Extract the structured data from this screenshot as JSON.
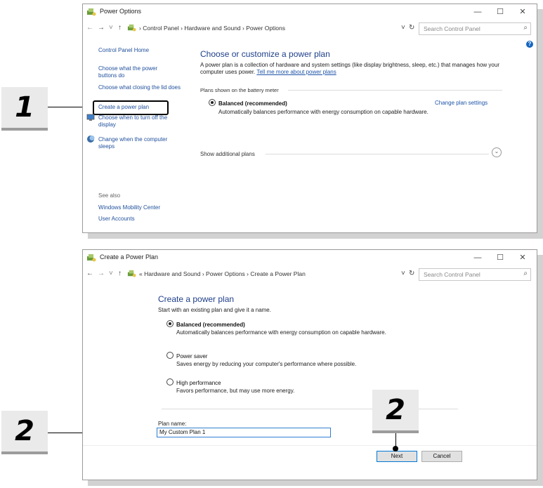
{
  "badges": {
    "one": "1",
    "two_left": "2",
    "two_right": "2"
  },
  "window1": {
    "title": "Power Options",
    "controls": {
      "min": "—",
      "max": "☐",
      "close": "✕"
    },
    "nav": {
      "back": "←",
      "forward": "→",
      "dropdown": "˅",
      "up": "↑"
    },
    "breadcrumb": [
      "Control Panel",
      "Hardware and Sound",
      "Power Options"
    ],
    "crumb_sep": "›",
    "refresh": "↻",
    "search_placeholder": "Search Control Panel",
    "help": "?",
    "sidebar": {
      "home": "Control Panel Home",
      "items": [
        "Choose what the power buttons do",
        "Choose what closing the lid does",
        "Create a power plan",
        "Choose when to turn off the display",
        "Change when the computer sleeps"
      ],
      "see_also": "See also",
      "see_also_links": [
        "Windows Mobility Center",
        "User Accounts"
      ]
    },
    "main": {
      "heading": "Choose or customize a power plan",
      "intro": "A power plan is a collection of hardware and system settings (like display brightness, sleep, etc.) that manages how your computer uses power.",
      "intro_link": "Tell me more about power plans",
      "group_label": "Plans shown on the battery meter",
      "plan_name": "Balanced (recommended)",
      "plan_desc": "Automatically balances performance with energy consumption on capable hardware.",
      "change_settings": "Change plan settings",
      "show_additional": "Show additional plans",
      "expand_icon": "⌄"
    }
  },
  "window2": {
    "title": "Create a Power Plan",
    "controls": {
      "min": "—",
      "max": "☐",
      "close": "✕"
    },
    "nav": {
      "back": "←",
      "forward": "→",
      "dropdown": "˅",
      "up": "↑"
    },
    "breadcrumb_prefix": "«",
    "breadcrumb": [
      "Hardware and Sound",
      "Power Options",
      "Create a Power Plan"
    ],
    "crumb_sep": "›",
    "refresh": "↻",
    "search_placeholder": "Search Control Panel",
    "heading": "Create a power plan",
    "intro": "Start with an existing plan and give it a name.",
    "plans": [
      {
        "name": "Balanced (recommended)",
        "desc": "Automatically balances performance with energy consumption on capable hardware.",
        "selected": true
      },
      {
        "name": "Power saver",
        "desc": "Saves energy by reducing your computer's performance where possible.",
        "selected": false
      },
      {
        "name": "High performance",
        "desc": "Favors performance, but may use more energy.",
        "selected": false
      }
    ],
    "plan_name_label": "Plan name:",
    "plan_name_value": "My Custom Plan 1",
    "next": "Next",
    "cancel": "Cancel"
  }
}
